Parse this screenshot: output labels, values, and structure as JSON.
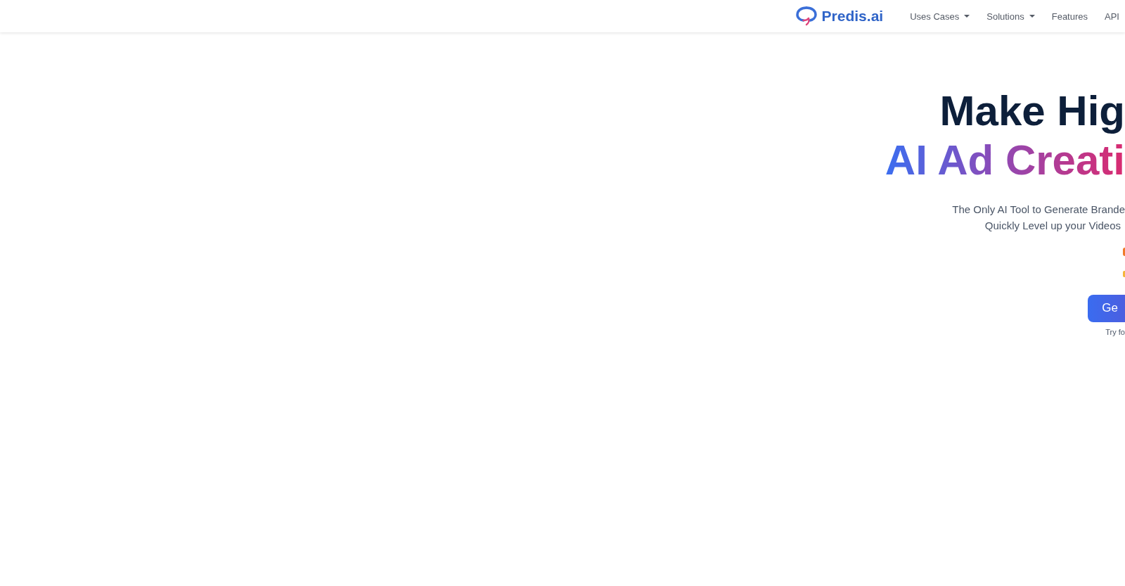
{
  "header": {
    "logo_text": "Predis.ai",
    "nav": [
      {
        "label": "Uses Cases",
        "dropdown": true
      },
      {
        "label": "Solutions",
        "dropdown": true
      },
      {
        "label": "Features",
        "dropdown": false
      },
      {
        "label": "API",
        "dropdown": false
      }
    ]
  },
  "hero": {
    "headline": "Make Hig",
    "headline_accent": "AI Ad Creati",
    "subtitle_lines": [
      "The Only AI Tool to Generate Brande",
      "Quickly Level up your Videos"
    ],
    "cta_button": "Ge",
    "cta_note": "Try fo"
  }
}
